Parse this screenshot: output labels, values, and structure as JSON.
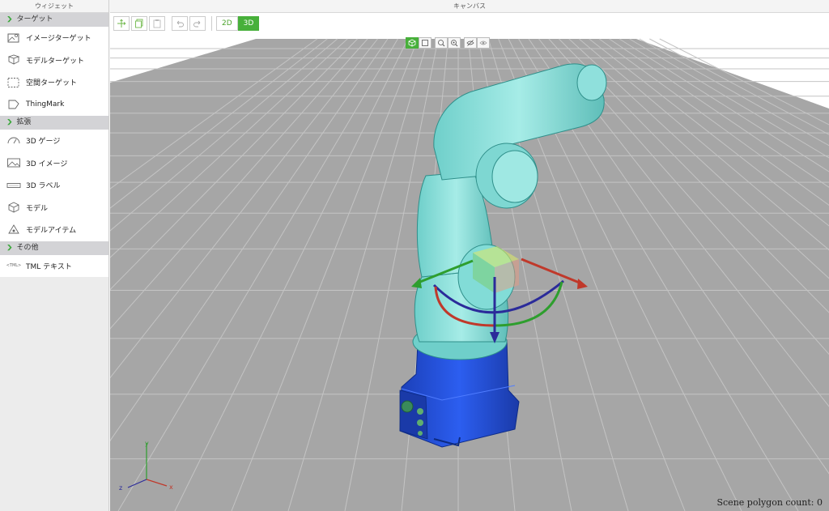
{
  "sidebar": {
    "title": "ウィジェット",
    "sections": [
      {
        "label": "ターゲット",
        "items": [
          {
            "label": "イメージターゲット",
            "icon": "image-target-icon"
          },
          {
            "label": "モデルターゲット",
            "icon": "model-target-icon"
          },
          {
            "label": "空間ターゲット",
            "icon": "spatial-target-icon"
          },
          {
            "label": "ThingMark",
            "icon": "thingmark-icon"
          }
        ]
      },
      {
        "label": "拡張",
        "items": [
          {
            "label": "3D ゲージ",
            "icon": "gauge-icon"
          },
          {
            "label": "3D イメージ",
            "icon": "image-icon"
          },
          {
            "label": "3D ラベル",
            "icon": "label-icon"
          },
          {
            "label": "モデル",
            "icon": "model-icon"
          },
          {
            "label": "モデルアイテム",
            "icon": "model-item-icon"
          }
        ]
      },
      {
        "label": "その他",
        "items": [
          {
            "label": "TML テキスト",
            "icon": "tml-icon",
            "icon_text": "<TML>"
          }
        ]
      }
    ]
  },
  "canvas": {
    "title": "キャンバス",
    "mode_2d": "2D",
    "mode_3d": "3D",
    "active_mode": "3D",
    "polygon_count_label": "Scene polygon count: 0",
    "axis_labels": {
      "x": "x",
      "y": "y",
      "z": "z"
    }
  },
  "colors": {
    "accent": "#47b03a",
    "robot_arm": "#8fe0dc",
    "robot_base": "#1f4fd6",
    "floor": "#a6a6a6",
    "grid_line": "#c4c4c4"
  }
}
